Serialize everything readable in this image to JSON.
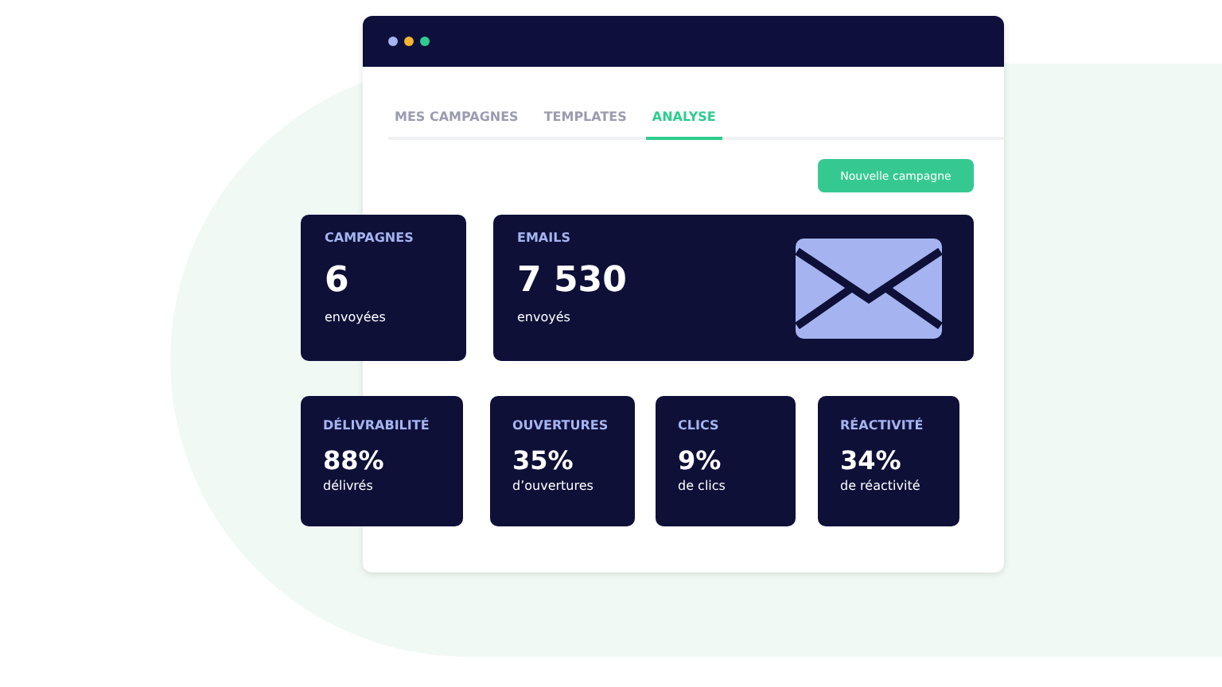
{
  "window": {
    "dots": [
      {
        "color": "#a5b4f0"
      },
      {
        "color": "#f5b52e"
      },
      {
        "color": "#2ecc8f"
      }
    ]
  },
  "tabs": [
    {
      "label": "MES CAMPAGNES",
      "selected": false
    },
    {
      "label": "TEMPLATES",
      "selected": false
    },
    {
      "label": "ANALYSE",
      "selected": true
    }
  ],
  "new_campaign_button": "Nouvelle campagne",
  "summary_cards": [
    {
      "kind": "plain",
      "title": "CAMPAGNES",
      "value": "6",
      "caption": "envoyées"
    },
    {
      "kind": "envelope",
      "title": "EMAILS",
      "value": "7 530",
      "caption": "envoyés"
    }
  ],
  "rate_cards": [
    {
      "title": "DÉLIVRABILITÉ",
      "value": "88%",
      "caption": "délivrés"
    },
    {
      "title": "OUVERTURES",
      "value": "35%",
      "caption": "d’ouvertures"
    },
    {
      "title": "CLICS",
      "value": "9%",
      "caption": "de clics"
    },
    {
      "title": "RÉACTIVITÉ",
      "value": "34%",
      "caption": "de réactivité"
    }
  ]
}
